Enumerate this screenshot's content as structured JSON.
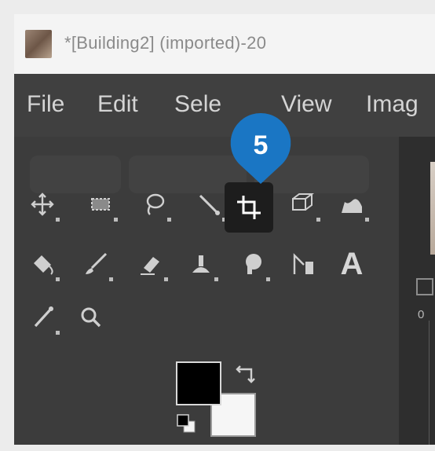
{
  "window": {
    "title": "*[Building2] (imported)-20",
    "app_icon": "image-thumbnail-icon"
  },
  "menu": {
    "items": [
      "File",
      "Edit",
      "Sele",
      "View",
      "Imag"
    ]
  },
  "toolbox": {
    "row1": [
      "move-tool-icon",
      "rect-select-icon",
      "free-select-icon",
      "paths-pen-icon",
      "crop-tool-icon",
      "3d-transform-icon",
      "warp-transform-icon"
    ],
    "row2": [
      "bucket-fill-icon",
      "paintbrush-icon",
      "eraser-icon",
      "clone-icon",
      "smudge-icon",
      "measure-icon",
      "text-tool-icon"
    ],
    "row3": [
      "color-picker-icon",
      "zoom-icon"
    ],
    "text_tool_glyph": "A",
    "active_tool": "crop-tool-icon"
  },
  "callout": {
    "number": "5",
    "color": "#1a76c4"
  },
  "colors": {
    "foreground": "#000000",
    "background": "#f6f6f6"
  },
  "ruler": {
    "label": "0"
  }
}
